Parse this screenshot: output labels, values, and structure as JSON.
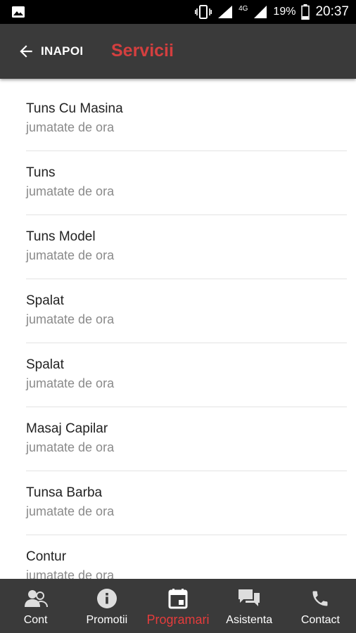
{
  "status_bar": {
    "network": "4G",
    "battery": "19%",
    "time": "20:37",
    "icons": [
      "image-icon",
      "vibrate-icon",
      "wifi-signal-icon",
      "cell-signal-icon",
      "battery-icon"
    ]
  },
  "app_bar": {
    "back_label": "INAPOI",
    "title": "Servicii",
    "title_color": "#d43f3f"
  },
  "services": [
    {
      "name": "Tuns Cu Masina",
      "duration": "jumatate de ora"
    },
    {
      "name": "Tuns",
      "duration": "jumatate de ora"
    },
    {
      "name": "Tuns Model",
      "duration": "jumatate de ora"
    },
    {
      "name": "Spalat",
      "duration": "jumatate de ora"
    },
    {
      "name": "Spalat",
      "duration": "jumatate de ora"
    },
    {
      "name": "Masaj Capilar",
      "duration": "jumatate de ora"
    },
    {
      "name": "Tunsa Barba",
      "duration": "jumatate de ora"
    },
    {
      "name": "Contur",
      "duration": "jumatate de ora"
    }
  ],
  "bottom_nav": {
    "active": "Programari",
    "active_color": "#e53c3c",
    "tabs": [
      {
        "label": "Cont",
        "icon": "people-icon"
      },
      {
        "label": "Promotii",
        "icon": "info-icon"
      },
      {
        "label": "Programari",
        "icon": "calendar-icon"
      },
      {
        "label": "Asistenta",
        "icon": "chat-icon"
      },
      {
        "label": "Contact",
        "icon": "phone-icon"
      }
    ]
  }
}
